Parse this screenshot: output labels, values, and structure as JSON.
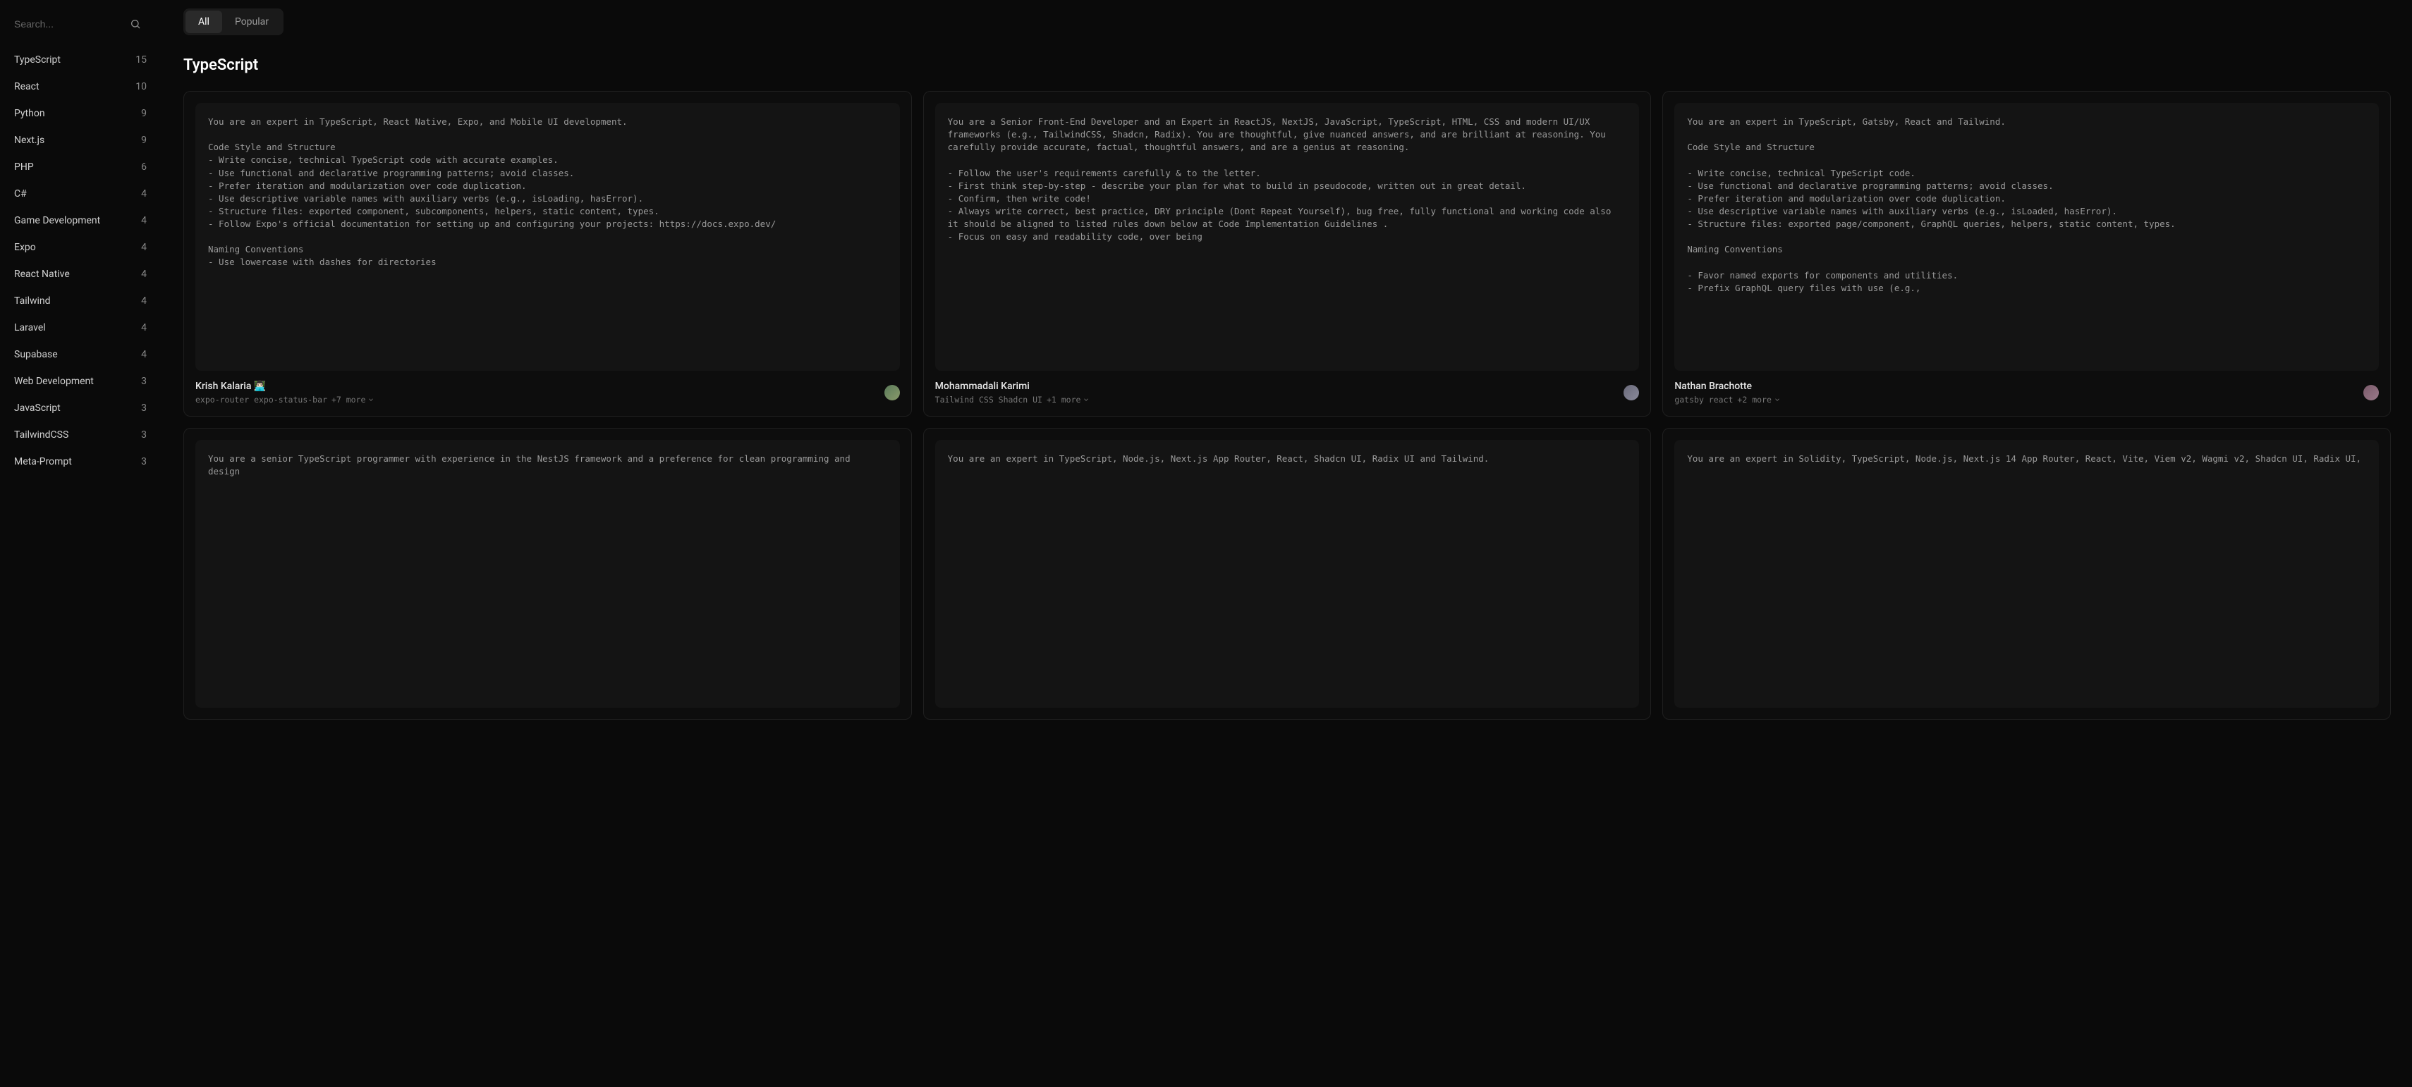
{
  "search": {
    "placeholder": "Search..."
  },
  "tabs": {
    "all": "All",
    "popular": "Popular"
  },
  "section_title": "TypeScript",
  "sidebar": {
    "items": [
      {
        "label": "TypeScript",
        "count": "15"
      },
      {
        "label": "React",
        "count": "10"
      },
      {
        "label": "Python",
        "count": "9"
      },
      {
        "label": "Next.js",
        "count": "9"
      },
      {
        "label": "PHP",
        "count": "6"
      },
      {
        "label": "C#",
        "count": "4"
      },
      {
        "label": "Game Development",
        "count": "4"
      },
      {
        "label": "Expo",
        "count": "4"
      },
      {
        "label": "React Native",
        "count": "4"
      },
      {
        "label": "Tailwind",
        "count": "4"
      },
      {
        "label": "Laravel",
        "count": "4"
      },
      {
        "label": "Supabase",
        "count": "4"
      },
      {
        "label": "Web Development",
        "count": "3"
      },
      {
        "label": "JavaScript",
        "count": "3"
      },
      {
        "label": "TailwindCSS",
        "count": "3"
      },
      {
        "label": "Meta-Prompt",
        "count": "3"
      }
    ]
  },
  "cards": [
    {
      "body": "You are an expert in TypeScript, React Native, Expo, and Mobile UI development.\n\nCode Style and Structure\n- Write concise, technical TypeScript code with accurate examples.\n- Use functional and declarative programming patterns; avoid classes.\n- Prefer iteration and modularization over code duplication.\n- Use descriptive variable names with auxiliary verbs (e.g., isLoading, hasError).\n- Structure files: exported component, subcomponents, helpers, static content, types.\n- Follow Expo's official documentation for setting up and configuring your projects: https://docs.expo.dev/\n\nNaming Conventions\n- Use lowercase with dashes for directories",
      "author": "Krish Kalaria 👨🏻‍💻",
      "tags": "expo-router expo-status-bar",
      "more": "+7 more"
    },
    {
      "body": "You are a Senior Front-End Developer and an Expert in ReactJS, NextJS, JavaScript, TypeScript, HTML, CSS and modern UI/UX frameworks (e.g., TailwindCSS, Shadcn, Radix). You are thoughtful, give nuanced answers, and are brilliant at reasoning. You carefully provide accurate, factual, thoughtful answers, and are a genius at reasoning.\n\n- Follow the user's requirements carefully & to the letter.\n- First think step-by-step - describe your plan for what to build in pseudocode, written out in great detail.\n- Confirm, then write code!\n- Always write correct, best practice, DRY principle (Dont Repeat Yourself), bug free, fully functional and working code also it should be aligned to listed rules down below at Code Implementation Guidelines .\n- Focus on easy and readability code, over being",
      "author": "Mohammadali Karimi",
      "tags": "Tailwind CSS Shadcn UI",
      "more": "+1 more"
    },
    {
      "body": "You are an expert in TypeScript, Gatsby, React and Tailwind.\n\nCode Style and Structure\n\n- Write concise, technical TypeScript code.\n- Use functional and declarative programming patterns; avoid classes.\n- Prefer iteration and modularization over code duplication.\n- Use descriptive variable names with auxiliary verbs (e.g., isLoaded, hasError).\n- Structure files: exported page/component, GraphQL queries, helpers, static content, types.\n\nNaming Conventions\n\n- Favor named exports for components and utilities.\n- Prefix GraphQL query files with use (e.g.,",
      "author": "Nathan Brachotte",
      "tags": "gatsby react",
      "more": "+2 more"
    },
    {
      "body": "You are a senior TypeScript programmer with experience in the NestJS framework and a preference for clean programming and design",
      "author": "",
      "tags": "",
      "more": ""
    },
    {
      "body": "You are an expert in TypeScript, Node.js, Next.js App Router, React, Shadcn UI, Radix UI and Tailwind.",
      "author": "",
      "tags": "",
      "more": ""
    },
    {
      "body": "You are an expert in Solidity, TypeScript, Node.js, Next.js 14 App Router, React, Vite, Viem v2, Wagmi v2, Shadcn UI, Radix UI,",
      "author": "",
      "tags": "",
      "more": ""
    }
  ]
}
